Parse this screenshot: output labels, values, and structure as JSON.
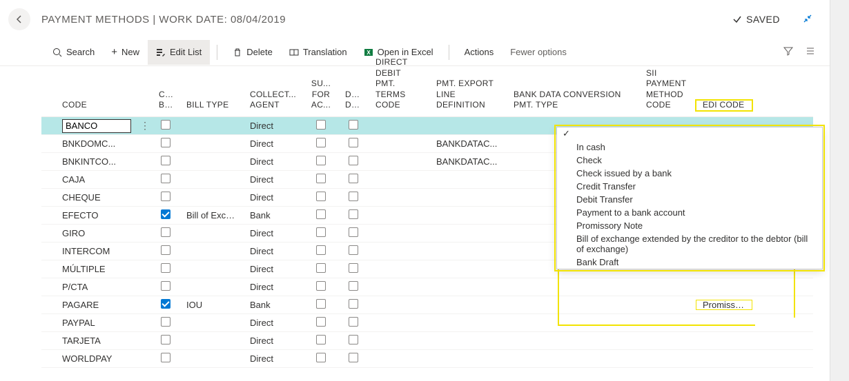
{
  "header": {
    "title": "PAYMENT METHODS | WORK DATE: 08/04/2019",
    "saved": "SAVED"
  },
  "toolbar": {
    "search": "Search",
    "new": "New",
    "edit_list": "Edit List",
    "delete": "Delete",
    "translation": "Translation",
    "open_excel": "Open in Excel",
    "actions": "Actions",
    "fewer": "Fewer options"
  },
  "columns": {
    "code": "CODE",
    "cr_bil": "CR... BIL...",
    "bill_type": "BILL TYPE",
    "collect_agent": "COLLECT... AGENT",
    "su_for_ac": "SU... FOR AC...",
    "dir_de": "DIR... DE...",
    "dd_pmt_terms": "DIRECT DEBIT PMT. TERMS CODE",
    "pmt_export": "PMT. EXPORT LINE DEFINITION",
    "bdc_pmt_type": "BANK DATA CONVERSION PMT. TYPE",
    "sii_pmc": "SII PAYMENT METHOD CODE",
    "edi_code": "EDI CODE"
  },
  "rows": [
    {
      "code": "BANCO",
      "cr": false,
      "bill": "",
      "collect": "Direct",
      "su": false,
      "dir": false,
      "pmt_export": "",
      "edi": "",
      "selected": true
    },
    {
      "code": "BNKDOMC...",
      "cr": false,
      "bill": "",
      "collect": "Direct",
      "su": false,
      "dir": false,
      "pmt_export": "BANKDATAC...",
      "edi": ""
    },
    {
      "code": "BNKINTCO...",
      "cr": false,
      "bill": "",
      "collect": "Direct",
      "su": false,
      "dir": false,
      "pmt_export": "BANKDATAC...",
      "edi": ""
    },
    {
      "code": "CAJA",
      "cr": false,
      "bill": "",
      "collect": "Direct",
      "su": false,
      "dir": false,
      "pmt_export": "",
      "edi": ""
    },
    {
      "code": "CHEQUE",
      "cr": false,
      "bill": "",
      "collect": "Direct",
      "su": false,
      "dir": false,
      "pmt_export": "",
      "edi": ""
    },
    {
      "code": "EFECTO",
      "cr": true,
      "bill": "Bill of Excha...",
      "collect": "Bank",
      "su": false,
      "dir": false,
      "pmt_export": "",
      "edi": ""
    },
    {
      "code": "GIRO",
      "cr": false,
      "bill": "",
      "collect": "Direct",
      "su": false,
      "dir": false,
      "pmt_export": "",
      "edi": ""
    },
    {
      "code": "INTERCOM",
      "cr": false,
      "bill": "",
      "collect": "Direct",
      "su": false,
      "dir": false,
      "pmt_export": "",
      "edi": ""
    },
    {
      "code": "MÚLTIPLE",
      "cr": false,
      "bill": "",
      "collect": "Direct",
      "su": false,
      "dir": false,
      "pmt_export": "",
      "edi": ""
    },
    {
      "code": "P/CTA",
      "cr": false,
      "bill": "",
      "collect": "Direct",
      "su": false,
      "dir": false,
      "pmt_export": "",
      "edi": ""
    },
    {
      "code": "PAGARE",
      "cr": true,
      "bill": "IOU",
      "collect": "Bank",
      "su": false,
      "dir": false,
      "pmt_export": "",
      "edi": "Promissory"
    },
    {
      "code": "PAYPAL",
      "cr": false,
      "bill": "",
      "collect": "Direct",
      "su": false,
      "dir": false,
      "pmt_export": "",
      "edi": ""
    },
    {
      "code": "TARJETA",
      "cr": false,
      "bill": "",
      "collect": "Direct",
      "su": false,
      "dir": false,
      "pmt_export": "",
      "edi": ""
    },
    {
      "code": "WORLDPAY",
      "cr": false,
      "bill": "",
      "collect": "Direct",
      "su": false,
      "dir": false,
      "pmt_export": "",
      "edi": ""
    }
  ],
  "dropdown": {
    "options": [
      "",
      "In cash",
      "Check",
      "Check issued by a bank",
      "Credit Transfer",
      "Debit Transfer",
      "Payment to a bank account",
      "Promissory Note",
      "Bill of exchange extended by the creditor to the debtor (bill of exchange)",
      "Bank Draft"
    ],
    "selected_index": 0
  }
}
